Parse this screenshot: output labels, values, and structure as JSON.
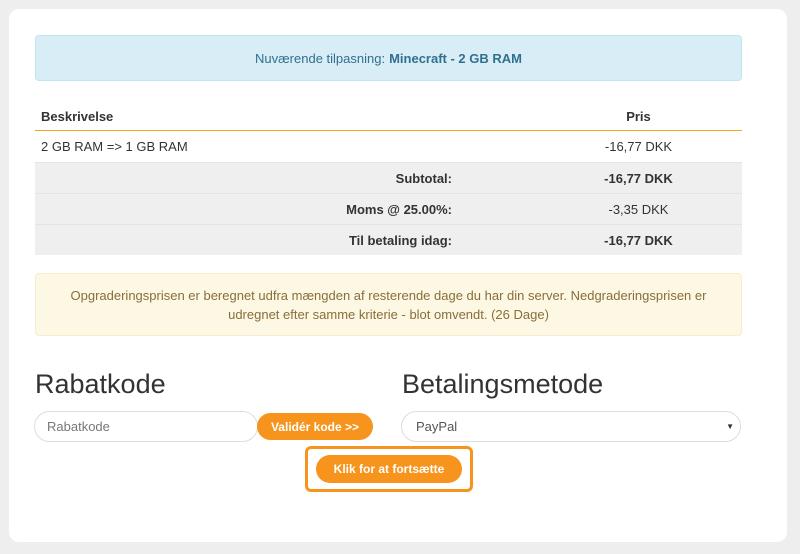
{
  "banner": {
    "label": "Nuværende tilpasning:",
    "value": "Minecraft - 2 GB RAM"
  },
  "table": {
    "headers": {
      "description": "Beskrivelse",
      "price": "Pris"
    },
    "items": [
      {
        "description": "2 GB RAM => 1 GB RAM",
        "price": "-16,77 DKK"
      }
    ],
    "subtotal": {
      "label": "Subtotal:",
      "value": "-16,77 DKK"
    },
    "tax": {
      "label": "Moms @ 25.00%:",
      "value": "-3,35 DKK"
    },
    "total": {
      "label": "Til betaling idag:",
      "value": "-16,77 DKK"
    }
  },
  "notice": "Opgraderingsprisen er beregnet udfra mængden af resterende dage du har din server. Nedgraderingsprisen er udregnet efter samme kriterie - blot omvendt. (26 Dage)",
  "coupon": {
    "title": "Rabatkode",
    "placeholder": "Rabatkode",
    "validate_label": "Validér kode >>"
  },
  "payment": {
    "title": "Betalingsmetode",
    "selected": "PayPal"
  },
  "continue_label": "Klik for at fortsætte",
  "colors": {
    "accent": "#f7941d",
    "info_bg": "#d9edf7",
    "warning_bg": "#fcf8e3"
  }
}
